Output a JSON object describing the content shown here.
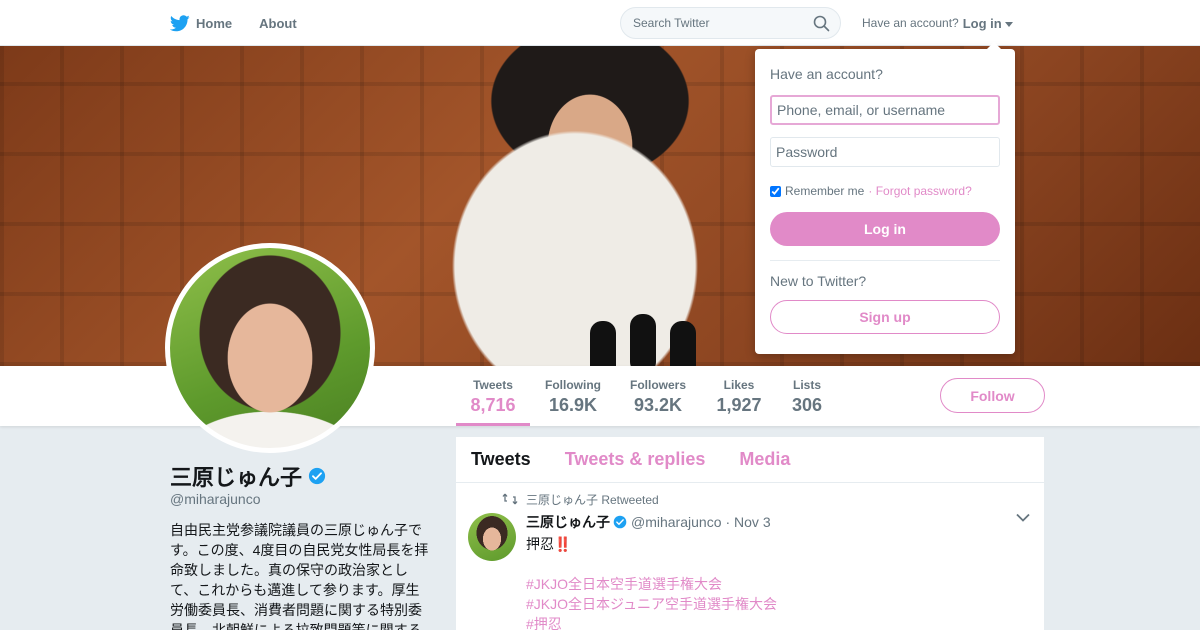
{
  "nav": {
    "home_label": "Home",
    "about_label": "About",
    "search_placeholder": "Search Twitter",
    "account_prompt": "Have an account?",
    "login_label": "Log in"
  },
  "profile": {
    "name": "三原じゅん子",
    "handle": "@miharajunco",
    "bio": "自由民主党参議院議員の三原じゅん子です。この度、4度目の自民党女性局長を拝命致しました。真の保守の政治家として、これからも邁進して参ります。厚生労働委員長、消費者問題に関する特別委員長、北朝鮮による拉致問題等に関する",
    "follow_label": "Follow"
  },
  "stats": [
    {
      "label": "Tweets",
      "value": "8,716"
    },
    {
      "label": "Following",
      "value": "16.9K"
    },
    {
      "label": "Followers",
      "value": "93.2K"
    },
    {
      "label": "Likes",
      "value": "1,927"
    },
    {
      "label": "Lists",
      "value": "306"
    }
  ],
  "timeline": {
    "tabs": [
      "Tweets",
      "Tweets & replies",
      "Media"
    ],
    "tweet": {
      "retweet_context": "三原じゅん子 Retweeted",
      "name": "三原じゅん子",
      "handle": "@miharajunco",
      "time": "· Nov 3",
      "text": "押忍",
      "emoji": "‼️",
      "hashtags": [
        "#JKJO全日本空手道選手権大会",
        "#JKJO全日本ジュニア空手道選手権大会",
        "#押忍"
      ]
    }
  },
  "login_dropdown": {
    "title": "Have an account?",
    "username_placeholder": "Phone, email, or username",
    "password_placeholder": "Password",
    "remember_label": "Remember me",
    "forgot_label": "· Forgot password?",
    "login_button": "Log in",
    "new_prompt": "New to Twitter?",
    "signup_button": "Sign up"
  },
  "colors": {
    "accent": "#e18ac8",
    "twitter_blue": "#1da1f2",
    "muted": "#66757f"
  }
}
